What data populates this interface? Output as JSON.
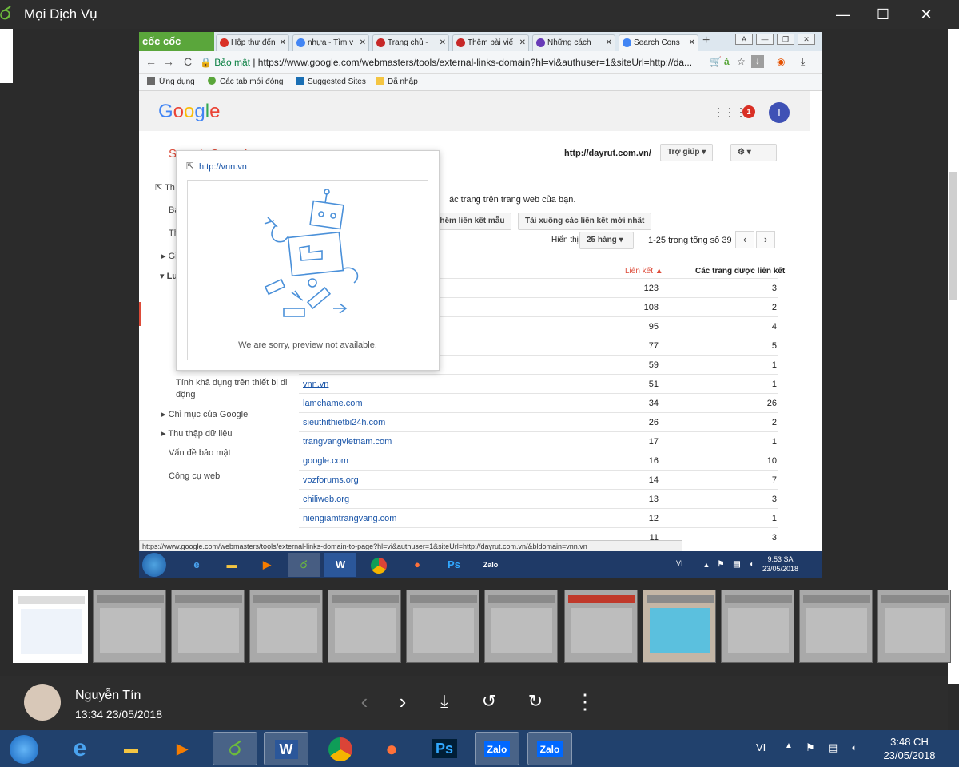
{
  "window": {
    "title": "Mọi Dịch Vụ",
    "minimize": "—",
    "maximize": "☐",
    "close": "✕"
  },
  "browser": {
    "brand": "cốc cốc",
    "tabs": [
      {
        "label": "Hộp thư đến",
        "icon_color": "#d93025"
      },
      {
        "label": "nhựa - Tìm v",
        "icon_color": "#4285f4"
      },
      {
        "label": "Trang chủ -",
        "icon_color": "#c62828"
      },
      {
        "label": "Thêm bài viế",
        "icon_color": "#c62828"
      },
      {
        "label": "Những cách",
        "icon_color": "#673ab7"
      },
      {
        "label": "Search Cons",
        "icon_color": "#4285f4"
      }
    ],
    "secure_label": "Bảo mật",
    "url": "https://www.google.com/webmasters/tools/external-links-domain?hl=vi&authuser=1&siteUrl=http://da...",
    "bookmarks": [
      "Ứng dụng",
      "Các tab mới đóng",
      "Suggested Sites",
      "Đã nhập"
    ]
  },
  "page": {
    "logo": "Google",
    "notif_count": "1",
    "avatar_letter": "T",
    "title_fragment": "Search Console",
    "site": "http://dayrut.com.vn/",
    "help_label": "Trợ giúp",
    "description": "ác trang trên trang web của bạn.",
    "btn_sample": "thêm liên kết mẫu",
    "btn_download": "Tải xuống các liên kết mới nhất",
    "show_label": "Hiển thị",
    "rows_select": "25 hàng",
    "row_count": "1-25 trong tổng số 39",
    "col_links": "Liên kết ▲",
    "col_pages": "Các trang được liên kết",
    "sidebar": {
      "th1": "Th",
      "ba": "Ba",
      "th2": "Th",
      "gi": "Gi",
      "lu": "Lu",
      "mobile": "Tính khả dụng trên thiết bị di động",
      "index": "Chỉ mục của Google",
      "crawl": "Thu thập dữ liệu",
      "security": "Vấn đề bảo mật",
      "tools": "Công cụ web"
    },
    "rows": [
      {
        "domain": "",
        "links": "123",
        "pages": "3"
      },
      {
        "domain": "",
        "links": "108",
        "pages": "2"
      },
      {
        "domain": "",
        "links": "95",
        "pages": "4"
      },
      {
        "domain": "",
        "links": "77",
        "pages": "5"
      },
      {
        "domain": "",
        "links": "59",
        "pages": "1"
      },
      {
        "domain": "vnn.vn",
        "links": "51",
        "pages": "1"
      },
      {
        "domain": "lamchame.com",
        "links": "34",
        "pages": "26"
      },
      {
        "domain": "sieuthithietbi24h.com",
        "links": "26",
        "pages": "2"
      },
      {
        "domain": "trangvangvietnam.com",
        "links": "17",
        "pages": "1"
      },
      {
        "domain": "google.com",
        "links": "16",
        "pages": "10"
      },
      {
        "domain": "vozforums.org",
        "links": "14",
        "pages": "7"
      },
      {
        "domain": "chiliweb.org",
        "links": "13",
        "pages": "3"
      },
      {
        "domain": "niengiamtrangvang.com",
        "links": "12",
        "pages": "1"
      },
      {
        "domain": "",
        "links": "11",
        "pages": "3"
      }
    ],
    "popup": {
      "link": "http://vnn.vn",
      "message": "We are sorry, preview not available."
    },
    "status_url": "https://www.google.com/webmasters/tools/external-links-domain-to-page?hl=vi&authuser=1&siteUrl=http://dayrut.com.vn/&bldomain=vnn.vn"
  },
  "inner_taskbar": {
    "lang": "VI",
    "time": "9:53 SA",
    "date": "23/05/2018"
  },
  "viewer": {
    "user": "Nguyễn Tín",
    "timestamp": "13:34 23/05/2018"
  },
  "taskbar": {
    "lang": "VI",
    "time": "3:48 CH",
    "date": "23/05/2018"
  }
}
